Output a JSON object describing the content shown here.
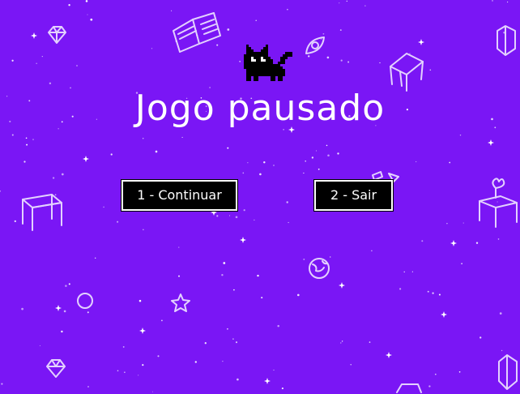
{
  "colors": {
    "background": "#7a16f5",
    "text": "#ffffff",
    "button_bg": "#000000",
    "button_border": "#ffffff",
    "cat": "#000000"
  },
  "pause_menu": {
    "title": "Jogo pausado",
    "buttons": [
      {
        "label": "1 - Continuar"
      },
      {
        "label": "2 - Sair"
      }
    ]
  },
  "decorations": [
    "cat-sprite",
    "book-icon",
    "gem-icon",
    "eye-icon",
    "table-icon",
    "planet-icon",
    "star-icon",
    "ring-icon",
    "flower-pot-icon",
    "sparkle-stars"
  ]
}
